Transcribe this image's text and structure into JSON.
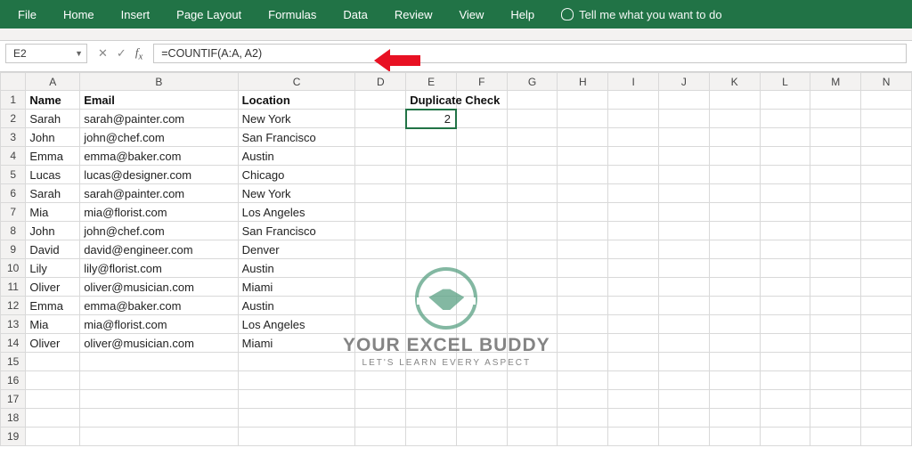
{
  "ribbon": {
    "tabs": [
      "File",
      "Home",
      "Insert",
      "Page Layout",
      "Formulas",
      "Data",
      "Review",
      "View",
      "Help"
    ],
    "tell_me": "Tell me what you want to do"
  },
  "formula_bar": {
    "cell_ref": "E2",
    "formula": "=COUNTIF(A:A, A2)"
  },
  "columns": [
    "A",
    "B",
    "C",
    "D",
    "E",
    "F",
    "G",
    "H",
    "I",
    "J",
    "K",
    "L",
    "M",
    "N"
  ],
  "headers": {
    "A": "Name",
    "B": "Email",
    "C": "Location",
    "E": "Duplicate Check"
  },
  "selected_value": "2",
  "rows": [
    {
      "n": "2",
      "A": "Sarah",
      "B": "sarah@painter.com",
      "C": "New York"
    },
    {
      "n": "3",
      "A": "John",
      "B": "john@chef.com",
      "C": "San Francisco"
    },
    {
      "n": "4",
      "A": "Emma",
      "B": "emma@baker.com",
      "C": "Austin"
    },
    {
      "n": "5",
      "A": "Lucas",
      "B": "lucas@designer.com",
      "C": "Chicago"
    },
    {
      "n": "6",
      "A": "Sarah",
      "B": "sarah@painter.com",
      "C": "New York"
    },
    {
      "n": "7",
      "A": "Mia",
      "B": "mia@florist.com",
      "C": "Los Angeles"
    },
    {
      "n": "8",
      "A": "John",
      "B": "john@chef.com",
      "C": "San Francisco"
    },
    {
      "n": "9",
      "A": "David",
      "B": "david@engineer.com",
      "C": "Denver"
    },
    {
      "n": "10",
      "A": "Lily",
      "B": "lily@florist.com",
      "C": "Austin"
    },
    {
      "n": "11",
      "A": "Oliver",
      "B": "oliver@musician.com",
      "C": "Miami"
    },
    {
      "n": "12",
      "A": "Emma",
      "B": "emma@baker.com",
      "C": "Austin"
    },
    {
      "n": "13",
      "A": "Mia",
      "B": "mia@florist.com",
      "C": "Los Angeles"
    },
    {
      "n": "14",
      "A": "Oliver",
      "B": "oliver@musician.com",
      "C": "Miami"
    }
  ],
  "empty_rows": [
    "15",
    "16",
    "17",
    "18",
    "19"
  ],
  "watermark": {
    "title": "YOUR EXCEL BUDDY",
    "sub": "LET'S LEARN EVERY ASPECT"
  }
}
